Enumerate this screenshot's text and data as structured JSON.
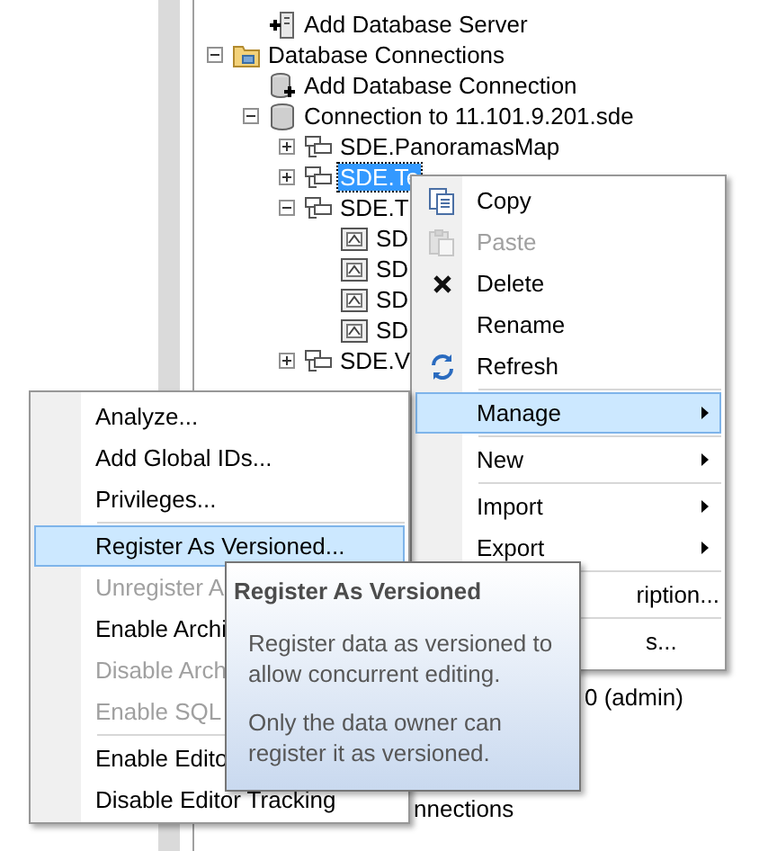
{
  "tree": [
    {
      "kind": "clipped-group",
      "children": [
        {
          "kind": "server-add",
          "label": "Add Database Server",
          "selected": false
        }
      ]
    },
    {
      "kind": "folder",
      "label": "Database Connections",
      "expanded": true,
      "selected": false,
      "children": [
        {
          "kind": "connection-add",
          "label": "Add Database Connection",
          "selected": false
        },
        {
          "kind": "database",
          "label": "Connection to 11.101.9.201.sde",
          "expanded": true,
          "selected": false,
          "children": [
            {
              "kind": "dataset",
              "label": "SDE.PanoramasMap",
              "expanded": false,
              "selected": false
            },
            {
              "kind": "dataset",
              "label": "SDE.Te",
              "expanded": false,
              "selected": true
            },
            {
              "kind": "dataset",
              "label": "SDE.T",
              "expanded": true,
              "selected": false,
              "children": [
                {
                  "kind": "feature-class",
                  "label": "SD",
                  "selected": false
                },
                {
                  "kind": "feature-class",
                  "label": "SD",
                  "selected": false
                },
                {
                  "kind": "feature-class",
                  "label": "SD",
                  "selected": false
                },
                {
                  "kind": "feature-class",
                  "label": "SD",
                  "selected": false
                }
              ]
            },
            {
              "kind": "dataset",
              "label": "SDE.V",
              "expanded": false,
              "selected": false
            }
          ]
        }
      ]
    }
  ],
  "tree_fragments": [
    "0 (admin)",
    "nnections"
  ],
  "context_menu": {
    "items": [
      {
        "kind": "item",
        "label": "Copy",
        "disabled": false,
        "selected": false
      },
      {
        "kind": "item",
        "label": "Paste",
        "disabled": true,
        "selected": false
      },
      {
        "kind": "item",
        "label": "Delete",
        "disabled": false,
        "selected": false
      },
      {
        "kind": "item",
        "label": "Rename",
        "disabled": false,
        "selected": false
      },
      {
        "kind": "item",
        "label": "Refresh",
        "disabled": false,
        "selected": false
      },
      {
        "kind": "separator"
      },
      {
        "kind": "item",
        "label": "Manage",
        "submenu": true,
        "disabled": false,
        "selected": true
      },
      {
        "kind": "separator"
      },
      {
        "kind": "item",
        "label": "New",
        "submenu": true,
        "disabled": false,
        "selected": false
      },
      {
        "kind": "separator"
      },
      {
        "kind": "item",
        "label": "Import",
        "submenu": true,
        "disabled": false,
        "selected": false
      },
      {
        "kind": "item",
        "label": "Export",
        "submenu": true,
        "disabled": false,
        "selected": false
      },
      {
        "kind": "separator"
      },
      {
        "kind": "covered",
        "label": "ription...",
        "disabled": false,
        "selected": false
      },
      {
        "kind": "separator"
      },
      {
        "kind": "covered",
        "label": "s...",
        "disabled": false,
        "selected": false
      }
    ]
  },
  "submenu": {
    "items": [
      {
        "kind": "item",
        "label": "Analyze...",
        "disabled": false,
        "selected": false
      },
      {
        "kind": "item",
        "label": "Add Global IDs...",
        "disabled": false,
        "selected": false
      },
      {
        "kind": "item",
        "label": "Privileges...",
        "disabled": false,
        "selected": false
      },
      {
        "kind": "separator"
      },
      {
        "kind": "item",
        "label": "Register As Versioned...",
        "disabled": false,
        "selected": true
      },
      {
        "kind": "item",
        "label": "Unregister A",
        "disabled": true,
        "selected": false
      },
      {
        "kind": "item",
        "label": "Enable Archi",
        "disabled": false,
        "selected": false
      },
      {
        "kind": "item",
        "label": "Disable Arch",
        "disabled": true,
        "selected": false
      },
      {
        "kind": "item",
        "label": "Enable SQL",
        "disabled": true,
        "selected": false
      },
      {
        "kind": "separator"
      },
      {
        "kind": "item",
        "label": "Enable Edito",
        "disabled": false,
        "selected": false
      },
      {
        "kind": "item",
        "label": "Disable Editor Tracking",
        "disabled": false,
        "selected": false
      }
    ]
  },
  "tooltip": {
    "title": "Register As Versioned",
    "paragraphs": [
      "Register data as versioned to allow concurrent editing.",
      "Only the data owner can register it as versioned."
    ]
  }
}
